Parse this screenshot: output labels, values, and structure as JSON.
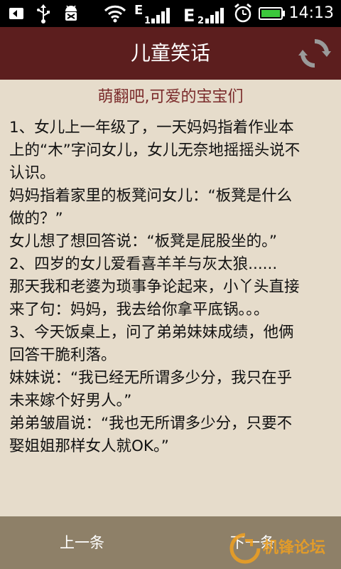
{
  "status_bar": {
    "time": "14:13",
    "icons": [
      "usb-debug-icon",
      "usb-icon",
      "android-debug-icon",
      "wifi-icon",
      "edge-signal-icon",
      "edge-2-signal-icon",
      "alarm-icon",
      "battery-icon"
    ],
    "battery_color": "#3cc83c"
  },
  "app": {
    "title": "儿童笑话"
  },
  "content": {
    "subtitle": "萌翻吧,可爱的宝宝们",
    "lines": [
      "1、女儿上一年级了，一天妈妈指着作业本",
      "上的“木”字问女儿，女儿无奈地摇摇头说不",
      "认识。",
      "妈妈指着家里的板凳问女儿：“板凳是什么",
      "做的？”",
      "女儿想了想回答说：“板凳是屁股坐的。”",
      "2、四岁的女儿爱看喜羊羊与灰太狼......",
      "那天我和老婆为琐事争论起来，小丫头直接",
      "来了句：妈妈，我去给你拿平底锅。。。",
      "3、今天饭桌上，问了弟弟妹妹成绩，他俩",
      "回答干脆利落。",
      "妹妹说：“我已经无所谓多少分，我只在乎",
      "未来嫁个好男人。”",
      "弟弟皱眉说：“我也无所谓多少分，只要不",
      "娶姐姐那样女人就OK。”"
    ]
  },
  "nav": {
    "prev_label": "上一条",
    "next_label": "下一条"
  },
  "watermark": {
    "text": "机锋论坛"
  },
  "colors": {
    "title_bar": "#5c1e1e",
    "content_bg": "#e6dccb",
    "subtitle": "#7a2a2a",
    "bottom_bar": "#8e8068"
  }
}
